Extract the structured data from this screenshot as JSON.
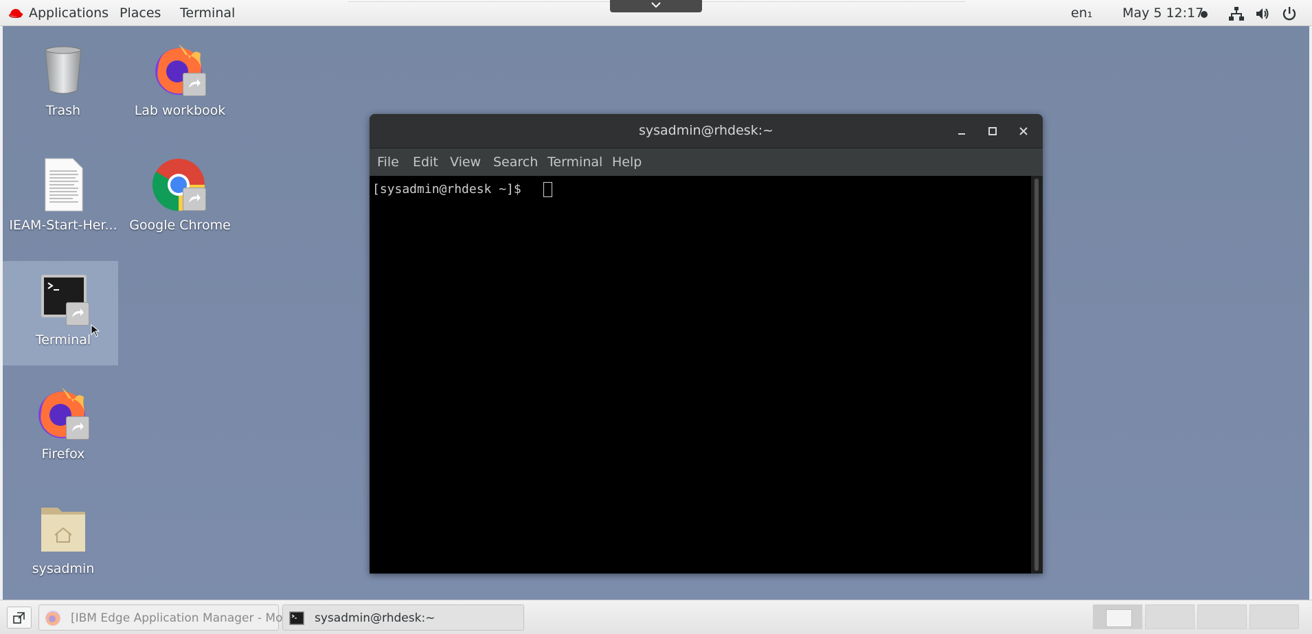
{
  "topbar": {
    "applications": "Applications",
    "places": "Places",
    "terminal": "Terminal",
    "language": "en₁",
    "clock": "May 5  12:17",
    "icons": [
      "redhat-logo",
      "network-icon",
      "volume-icon",
      "power-icon"
    ]
  },
  "desktop": {
    "icons": [
      {
        "label": "Trash",
        "icon": "trash-icon"
      },
      {
        "label": "Lab workbook",
        "icon": "firefox-icon"
      },
      {
        "label": "IEAM-Start-Her...",
        "icon": "document-icon"
      },
      {
        "label": "Google Chrome",
        "icon": "chrome-icon"
      },
      {
        "label": "Terminal",
        "icon": "terminal-icon"
      },
      {
        "label": "Firefox",
        "icon": "firefox-icon"
      },
      {
        "label": "sysadmin",
        "icon": "home-folder-icon"
      }
    ]
  },
  "terminal_window": {
    "title": "sysadmin@rhdesk:~",
    "menu": [
      "File",
      "Edit",
      "View",
      "Search",
      "Terminal",
      "Help"
    ],
    "prompt": "[sysadmin@rhdesk ~]$ "
  },
  "taskbar": {
    "tasks": [
      {
        "label": "[IBM Edge Application Manager - Mo...",
        "icon": "firefox-icon"
      },
      {
        "label": "sysadmin@rhdesk:~",
        "icon": "terminal-icon"
      }
    ],
    "workspaces": 4
  },
  "colors": {
    "desktop_bg": "#7a8aa8",
    "terminal_bg": "#000000",
    "titlebar_bg": "#2f3132"
  }
}
